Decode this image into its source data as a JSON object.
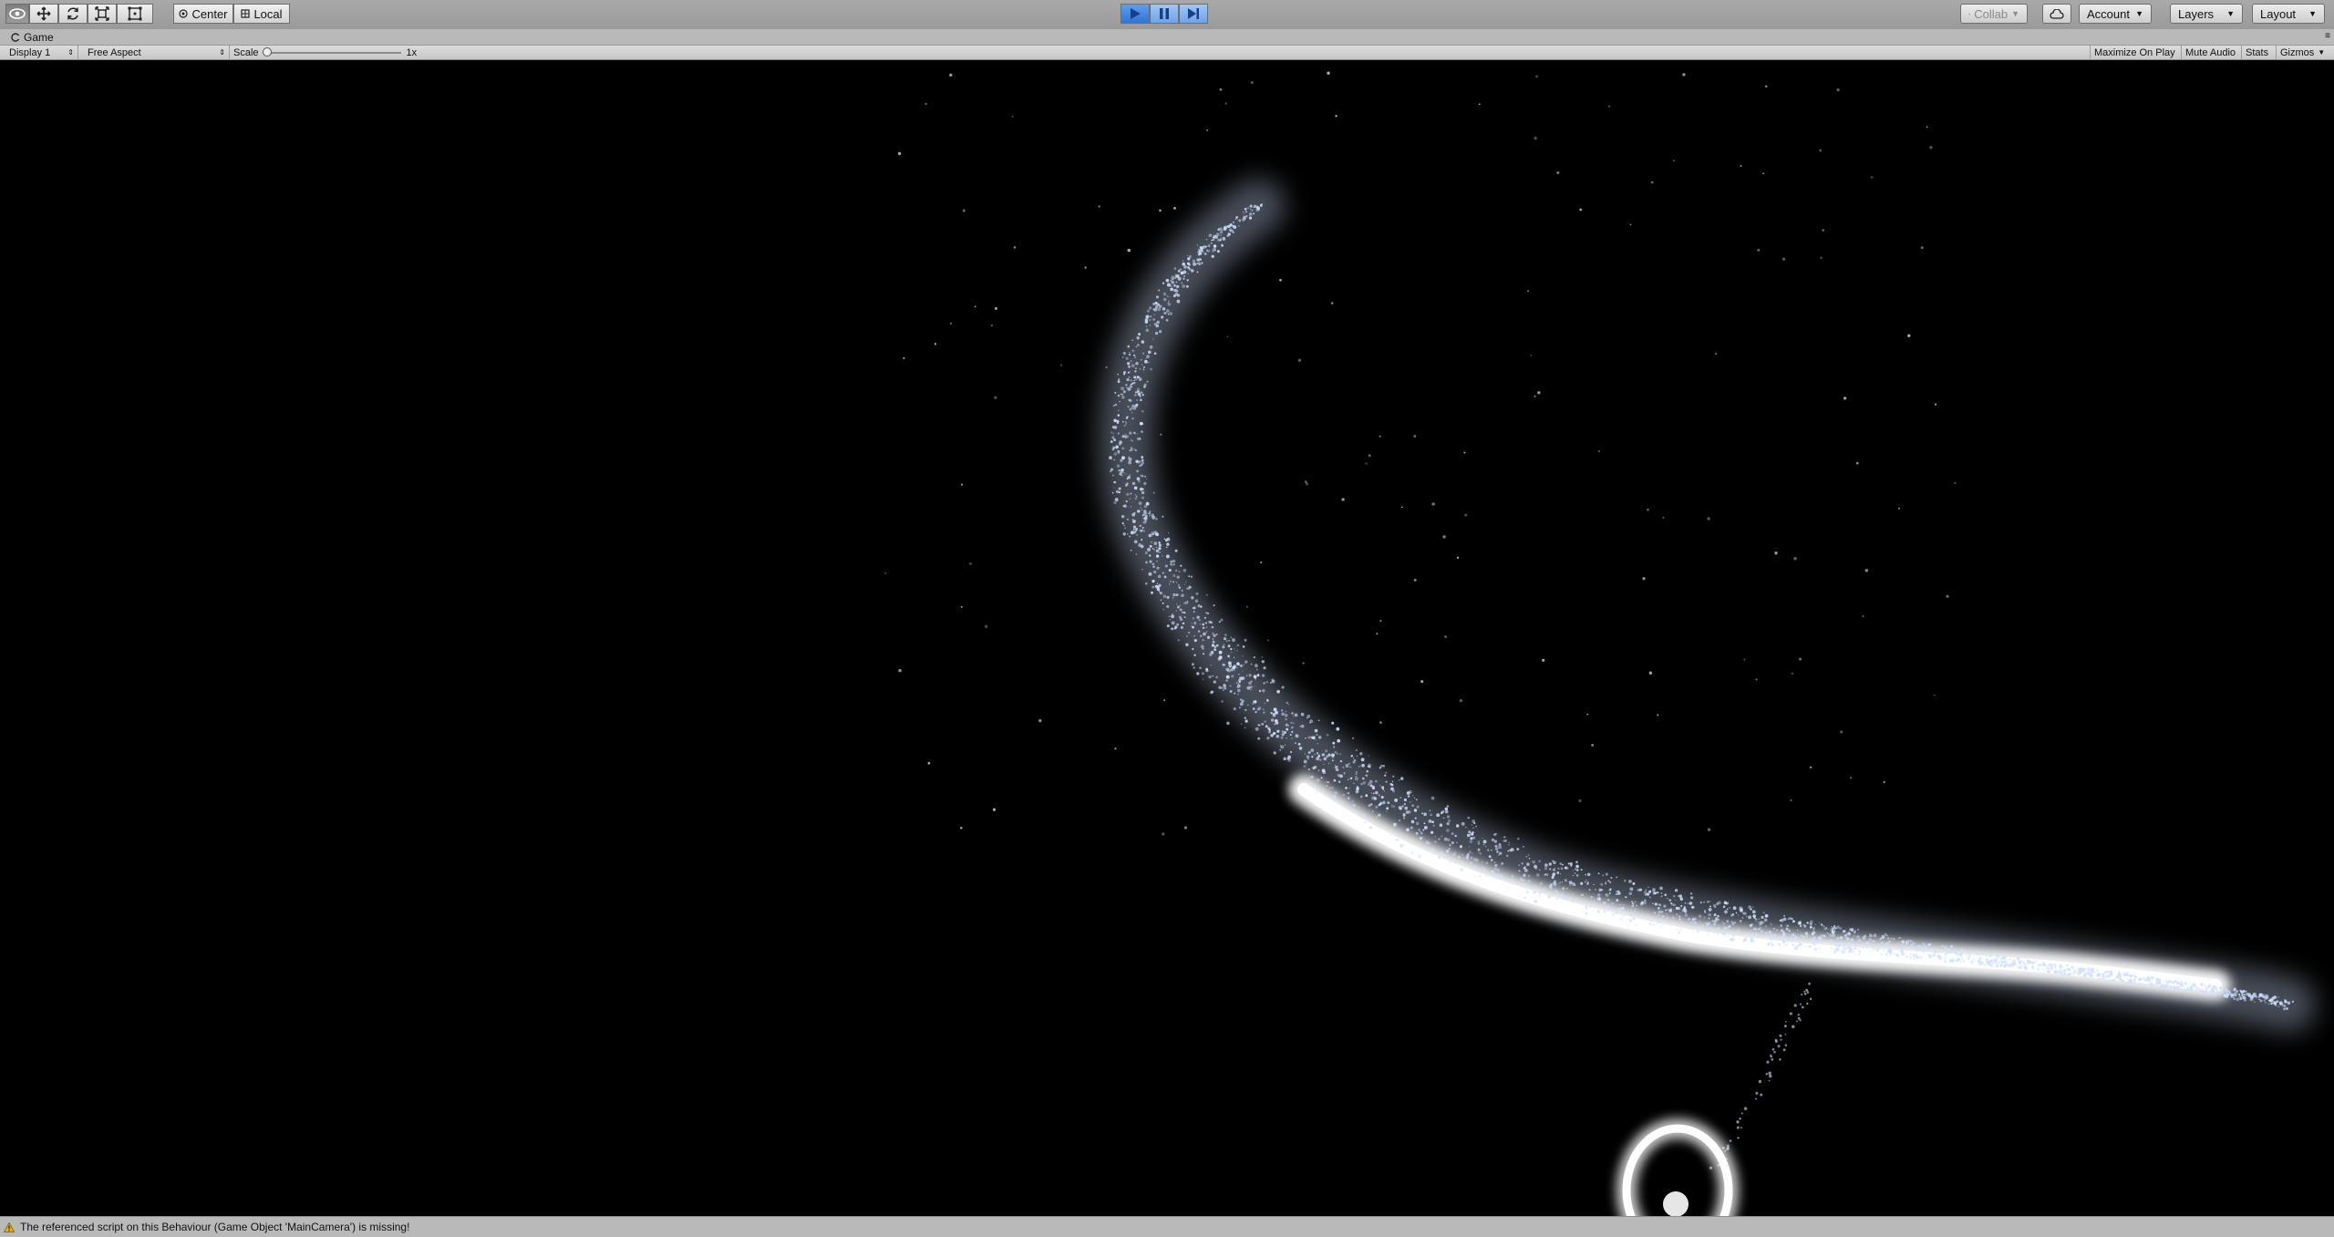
{
  "toolbar": {
    "tools": [
      "view-tool",
      "move-tool",
      "rotate-tool",
      "scale-tool",
      "rect-tool"
    ],
    "pivot_mode": "Center",
    "pivot_rotation": "Local",
    "collab": "Collab",
    "account": "Account",
    "layers": "Layers",
    "layout": "Layout"
  },
  "playback": {
    "playing": true
  },
  "tab": {
    "title": "Game"
  },
  "game_toolbar": {
    "display": "Display 1",
    "aspect": "Free Aspect",
    "scale_label": "Scale",
    "scale_value": "1x",
    "maximize_on_play": "Maximize On Play",
    "mute_audio": "Mute Audio",
    "stats": "Stats",
    "gizmos": "Gizmos"
  },
  "status": {
    "message": "The referenced script on this Behaviour (Game Object 'MainCamera') is missing!",
    "icon": "warning-icon"
  },
  "colors": {
    "viewport_bg": "#000000",
    "particle": "#cfe0ff",
    "glow": "#ffffff",
    "play_active": "#3a82e6"
  }
}
